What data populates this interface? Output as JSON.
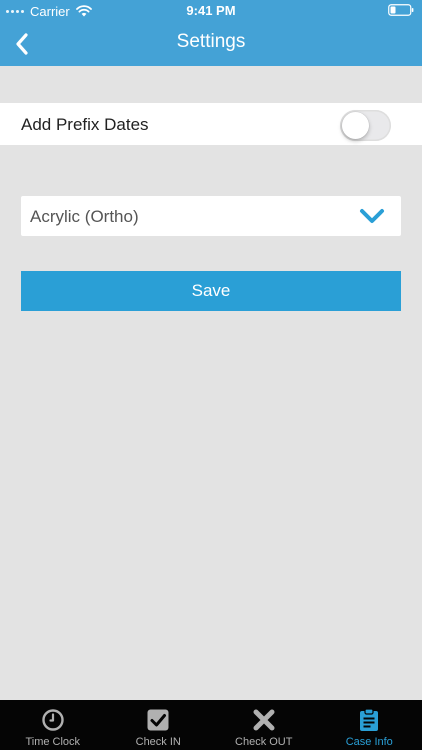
{
  "status_bar": {
    "carrier": "Carrier",
    "time": "9:41 PM"
  },
  "nav": {
    "title": "Settings",
    "back_icon": "chevron-left-icon"
  },
  "settings": {
    "prefix_dates_label": "Add Prefix Dates",
    "prefix_dates_enabled": false,
    "material_select_value": "Acrylic (Ortho)",
    "save_label": "Save"
  },
  "tabs": [
    {
      "label": "Time Clock",
      "icon": "clock-icon",
      "active": false
    },
    {
      "label": "Check IN",
      "icon": "checkbox-icon",
      "active": false
    },
    {
      "label": "Check OUT",
      "icon": "x-icon",
      "active": false
    },
    {
      "label": "Case Info",
      "icon": "clipboard-icon",
      "active": true
    }
  ],
  "colors": {
    "header_blue": "#44a2d6",
    "accent_blue": "#2a9fd6",
    "background_gray": "#e3e3e3",
    "tabbar_black": "#050505"
  }
}
